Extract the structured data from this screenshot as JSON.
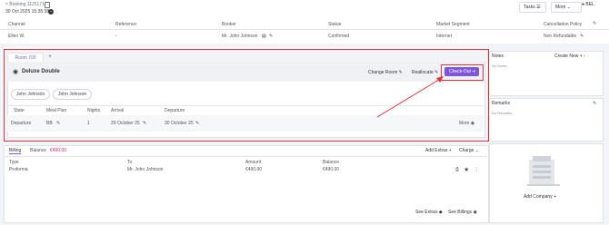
{
  "topbar": {
    "booking": "< Booking 1125171",
    "datetime": "30 Oct 2025 15:35:38",
    "tasks_label": "Tasks",
    "more_label": "More",
    "user_initials": "BEL"
  },
  "summary": {
    "headers": [
      "Channel",
      "Reference",
      "Booker",
      "Status",
      "Market Segment",
      "Cancellation Policy"
    ],
    "values": [
      "Ellen W.",
      "-",
      "Mr. John Johnson",
      "Confirmed",
      "Internet",
      "Non Refundable"
    ]
  },
  "room": {
    "tab_label": "Room 700",
    "add_tab": "+",
    "type": "Deluxe Double",
    "change_room": "Change Room",
    "reallocate": "Reallocate",
    "checkout": "Check-Out",
    "guests": [
      "John Johnson",
      "John Johnson"
    ],
    "table_headers": [
      "State",
      "Meal Plan",
      "Nights",
      "Arrival",
      "Departure"
    ],
    "row": {
      "state": "Departure",
      "meal_plan": "BB",
      "nights": "1",
      "arrival": "29 October 25",
      "departure": "30 October 25",
      "more": "More"
    }
  },
  "billing": {
    "tab_billing": "Billing",
    "tab_balance": "Balance",
    "balance_value": "€490.00",
    "add_extras": "Add Extras",
    "charge": "Charge",
    "headers": [
      "Type",
      "To",
      "Amount",
      "Balance"
    ],
    "row": {
      "type": "Proforma",
      "to": "Mr. John Johnson",
      "amount": "€490.00",
      "balance": "€490.00"
    },
    "see_extras": "See Extras",
    "see_billings": "See Billings"
  },
  "notes": {
    "title": "Notes",
    "create_new": "Create New",
    "empty": "No Notes"
  },
  "remarks": {
    "title": "Remarks",
    "empty": "No Remarks"
  },
  "company": {
    "add_label": "Add Company"
  },
  "colors": {
    "accent": "#7f56d9",
    "highlight": "#d9363e",
    "balance": "#e0245e"
  }
}
